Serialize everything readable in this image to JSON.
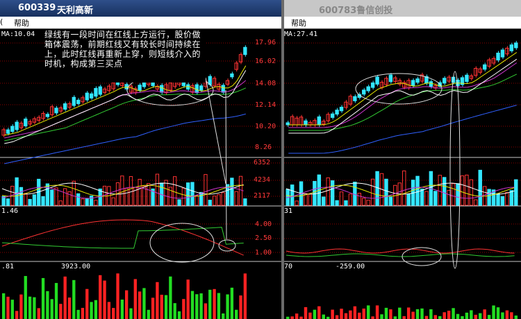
{
  "left": {
    "title": {
      "code": "600339",
      "name": "天利高新"
    },
    "menu": {
      "prefix": "(",
      "help": "帮助"
    },
    "price_panel": {
      "ma_label": "MA:10.04",
      "axis": [
        "17.96",
        "16.02",
        "14.08",
        "12.14",
        "10.20",
        "8.26"
      ]
    },
    "volume_panel": {
      "axis": [
        "6352",
        "4234",
        "2117"
      ]
    },
    "indicator_panel": {
      "value_label": "1.46",
      "axis": [
        "4.00",
        "2.50",
        "1.00"
      ]
    },
    "bottom_panel": {
      "value_label": ".81",
      "value2": "3923.00"
    }
  },
  "right": {
    "title": {
      "code": "600783鲁信创投"
    },
    "menu": {
      "help": "帮助"
    },
    "price_panel": {
      "ma_label": "MA:27.41"
    },
    "indicator_panel": {
      "value_label": "31"
    },
    "bottom_panel": {
      "value_label": "70",
      "value2": "-259.00"
    }
  },
  "annotation": {
    "text": "绿线有一段时间在红线上方运行，股价做箱体震荡，前期红线又有较长时间持续在上，此时红线再重新上穿，则短线介入的时机，构成第三买点"
  },
  "colors": {
    "up": "#ff3333",
    "down": "#33e6ff",
    "ma_yellow": "#e8e800",
    "ma_green": "#33cc33",
    "ma_magenta": "#cc33cc",
    "grid": "#8b0000"
  }
}
